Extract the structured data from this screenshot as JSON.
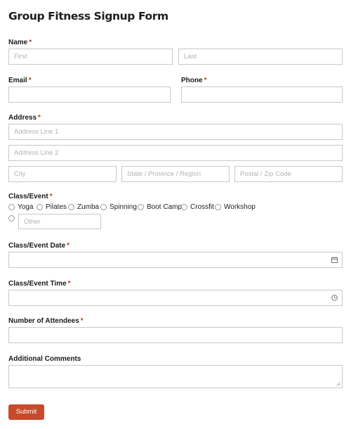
{
  "form": {
    "title": "Group Fitness Signup Form",
    "required_mark": "*",
    "name": {
      "label": "Name",
      "first_placeholder": "First",
      "last_placeholder": "Last"
    },
    "email": {
      "label": "Email"
    },
    "phone": {
      "label": "Phone"
    },
    "address": {
      "label": "Address",
      "line1_placeholder": "Address Line 1",
      "line2_placeholder": "Address Line 2",
      "city_placeholder": "City",
      "state_placeholder": "State / Province / Region",
      "zip_placeholder": "Postal / Zip Code"
    },
    "class_event": {
      "label": "Class/Event",
      "options": [
        "Yoga",
        "Pilates",
        "Zumba",
        "Spinning",
        "Boot Camp",
        "Crossfit",
        "Workshop"
      ],
      "other_placeholder": "Other"
    },
    "date": {
      "label": "Class/Event Date",
      "icon": "calendar-icon"
    },
    "time": {
      "label": "Class/Event Time",
      "icon": "clock-icon"
    },
    "attendees": {
      "label": "Number of Attendees"
    },
    "comments": {
      "label": "Additional Comments"
    },
    "submit_label": "Submit"
  },
  "colors": {
    "accent": "#c74b2a",
    "required": "#c0392b",
    "border": "#c9c9c9",
    "placeholder": "#b3b3b3"
  }
}
